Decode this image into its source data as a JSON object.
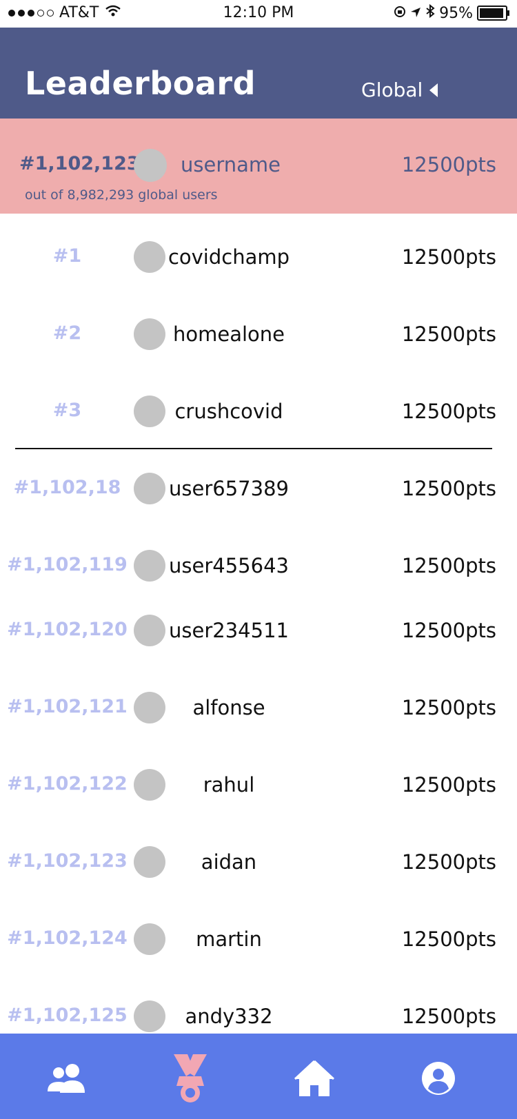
{
  "status_bar": {
    "carrier": "AT&T",
    "time": "12:10 PM",
    "battery": "95%"
  },
  "header": {
    "title": "Leaderboard",
    "scope": "Global"
  },
  "current_user": {
    "rank": "#1,102,123",
    "username": "username",
    "points": "12500pts",
    "subtitle": "out of 8,982,293 global users"
  },
  "top_entries": [
    {
      "rank": "#1",
      "username": "covidchamp",
      "points": "12500pts"
    },
    {
      "rank": "#2",
      "username": "homealone",
      "points": "12500pts"
    },
    {
      "rank": "#3",
      "username": "crushcovid",
      "points": "12500pts"
    }
  ],
  "nearby_entries": [
    {
      "rank": "#1,102,18",
      "username": "user657389",
      "points": "12500pts"
    },
    {
      "rank": "#1,102,119",
      "username": "user455643",
      "points": "12500pts"
    },
    {
      "rank": "#1,102,120",
      "username": "user234511",
      "points": "12500pts"
    },
    {
      "rank": "#1,102,121",
      "username": "alfonse",
      "points": "12500pts"
    },
    {
      "rank": "#1,102,122",
      "username": "rahul",
      "points": "12500pts"
    },
    {
      "rank": "#1,102,123",
      "username": "aidan",
      "points": "12500pts"
    },
    {
      "rank": "#1,102,124",
      "username": "martin",
      "points": "12500pts"
    },
    {
      "rank": "#1,102,125",
      "username": "andy332",
      "points": "12500pts"
    }
  ],
  "tabs": [
    {
      "icon": "friends-icon",
      "active": false
    },
    {
      "icon": "medal-icon",
      "active": true
    },
    {
      "icon": "home-icon",
      "active": false
    },
    {
      "icon": "profile-icon",
      "active": false
    }
  ],
  "colors": {
    "header_bg": "#4f5a89",
    "highlight_bg": "#efadad",
    "rank_text": "#b8bff0",
    "tab_bar_bg": "#5b7ae8",
    "active_tab_icon": "#f2a7b3"
  }
}
